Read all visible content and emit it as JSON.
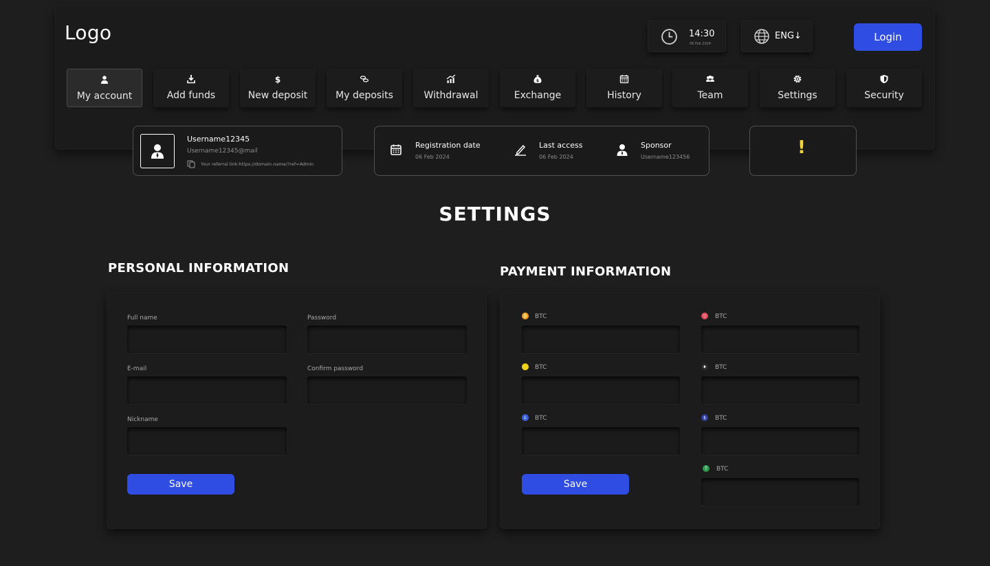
{
  "header": {
    "logo": "Logo",
    "clock": {
      "time": "14:30",
      "date": "06 Feb 2024"
    },
    "language": "ENG↓",
    "login_label": "Login"
  },
  "nav": {
    "items": [
      {
        "label": "My account",
        "icon": "user-icon",
        "active": true
      },
      {
        "label": "Add funds",
        "icon": "download-icon"
      },
      {
        "label": "New deposit",
        "icon": "dollar-icon"
      },
      {
        "label": "My deposits",
        "icon": "coins-icon"
      },
      {
        "label": "Withdrawal",
        "icon": "chart-up-icon"
      },
      {
        "label": "Exchange",
        "icon": "money-bag-icon"
      },
      {
        "label": "History",
        "icon": "calendar-icon"
      },
      {
        "label": "Team",
        "icon": "team-icon"
      },
      {
        "label": "Settings",
        "icon": "gear-icon"
      },
      {
        "label": "Security",
        "icon": "shield-icon"
      }
    ]
  },
  "user": {
    "username": "Username12345",
    "email": "Username12345@mail",
    "referral_link": "Your referral link:https://domain.name/?ref=Admin"
  },
  "meta": {
    "registration": {
      "title": "Registration date",
      "value": "06 Feb 2024"
    },
    "last_access": {
      "title": "Last access",
      "value": "06 Feb 2024"
    },
    "sponsor": {
      "title": "Sponsor",
      "value": "Username123456"
    }
  },
  "alert": {
    "mark": "!"
  },
  "page_title": "SETTINGS",
  "personal": {
    "title": "PERSONAL INFORMATION",
    "fields": {
      "full_name": "Full name",
      "password": "Password",
      "email": "E-mail",
      "confirm_password": "Confirm password",
      "nickname": "Nickname"
    },
    "save_label": "Save"
  },
  "payment": {
    "title": "PAYMENT INFORMATION",
    "wallets": [
      {
        "label": "BTC",
        "coin_color": "#f2a11f"
      },
      {
        "label": "BTC",
        "coin_color": "#e04a5a"
      },
      {
        "label": "BTC",
        "coin_color": "#f1d21b"
      },
      {
        "label": "BTC",
        "coin_color": "#2a2a2a"
      },
      {
        "label": "BTC",
        "coin_color": "#3a5fd9"
      },
      {
        "label": "BTC",
        "coin_color": "#2e3f9e"
      },
      {
        "label": "BTC",
        "coin_color": "#2f9a4d"
      }
    ],
    "save_label": "Save"
  },
  "colors": {
    "background": "#1e1e1e",
    "accent": "#2f4de3",
    "warning": "#f3d43a"
  }
}
